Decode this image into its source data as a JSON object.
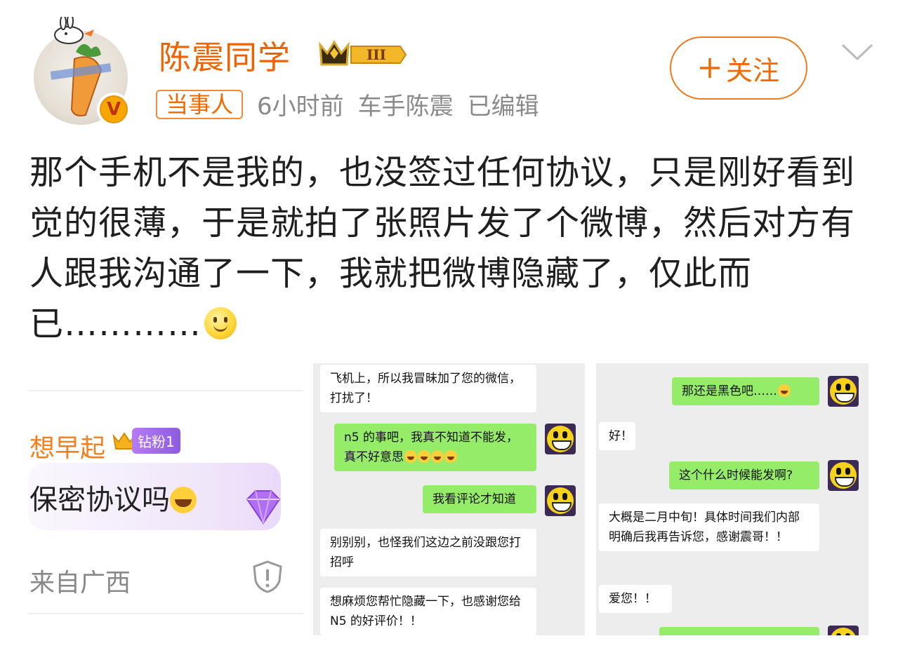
{
  "header": {
    "username": "陈震同学",
    "level_badge": "III",
    "role_tag": "当事人",
    "time": "6小时前",
    "source": "车手陈震",
    "edited": "已编辑",
    "follow_label": "关注",
    "verified_badge": "V"
  },
  "post": {
    "text": "那个手机不是我的，也没签过任何协议，只是刚好看到觉的很薄，于是就拍了张照片发了个微博，然后对方有人跟我沟通了一下，我就把微博隐藏了，仅此而已…………"
  },
  "image1": {
    "nickname": "想早起",
    "fan_badge": "钻粉1",
    "comment": "保密协议吗",
    "location": "来自广西"
  },
  "chat1": {
    "messages": [
      {
        "side": "left",
        "text": "飞机上，所以我冒昧加了您的微信，打扰了！"
      },
      {
        "side": "right",
        "text": "n5 的事吧，我真不知道不能发，真不好意思"
      },
      {
        "side": "right",
        "text": "我看评论才知道"
      },
      {
        "side": "left",
        "text": "别别别，也怪我们这边之前没跟您打招呼"
      },
      {
        "side": "left",
        "text": "想麻烦您帮忙隐藏一下，也感谢您给 N5 的好评价！！"
      }
    ]
  },
  "chat2": {
    "messages": [
      {
        "side": "right",
        "text": "那还是黑色吧……"
      },
      {
        "side": "left",
        "text": "好！"
      },
      {
        "side": "right",
        "text": "这个什么时候能发啊?"
      },
      {
        "side": "left",
        "text": "大概是二月中旬！具体时间我们内部明确后我再告诉您，感谢震哥！！"
      },
      {
        "side": "left",
        "text": "爱您！！"
      }
    ]
  },
  "colors": {
    "accent": "#f06200",
    "wechat_green": "#95ec69",
    "chat_bg": "#ededed"
  }
}
